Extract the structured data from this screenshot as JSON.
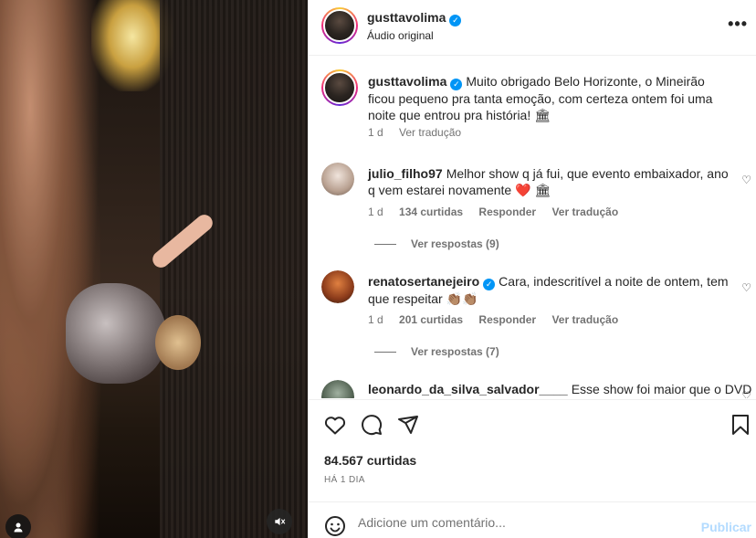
{
  "post": {
    "author": "gusttavolima",
    "audio_label": "Áudio original",
    "caption": {
      "username": "gusttavolima",
      "text": "Muito obrigado Belo Horizonte, o Mineirão ficou pequeno pra tanta emoção, com certeza ontem foi uma noite que entrou pra história! 🏛",
      "time": "1 d",
      "translate": "Ver tradução"
    },
    "comments": [
      {
        "username": "julio_filho97",
        "text": "Melhor show q já fui, que evento embaixador, ano q vem estarei novamente ❤️ 🏛",
        "time": "1 d",
        "likes": "134 curtidas",
        "reply": "Responder",
        "translate": "Ver tradução",
        "replies_label": "Ver respostas (9)"
      },
      {
        "username": "renatosertanejeiro",
        "text": "Cara, indescritível a noite de ontem, tem que respeitar 👏🏽👏🏽",
        "time": "1 d",
        "likes": "201 curtidas",
        "reply": "Responder",
        "translate": "Ver tradução",
        "replies_label": "Ver respostas (7)"
      },
      {
        "username": "leonardo_da_silva_salvador____",
        "text": "Esse show foi maior que o DVD"
      }
    ],
    "likes_count": "84.567 curtidas",
    "posted_ago": "HÁ 1 DIA",
    "add_comment_placeholder": "Adicione um comentário...",
    "publish_label": "Publicar"
  },
  "icons": {
    "more": "more-options-icon",
    "like": "heart-icon",
    "comment": "comment-icon",
    "share": "send-icon",
    "save": "bookmark-icon",
    "emoji": "emoji-icon",
    "mute": "muted-speaker-icon",
    "tags": "user-tag-icon"
  },
  "colors": {
    "verified": "#0095f6",
    "secondary_text": "#737373",
    "publish_disabled": "#b3dbff",
    "like_red": "#ed4956"
  }
}
